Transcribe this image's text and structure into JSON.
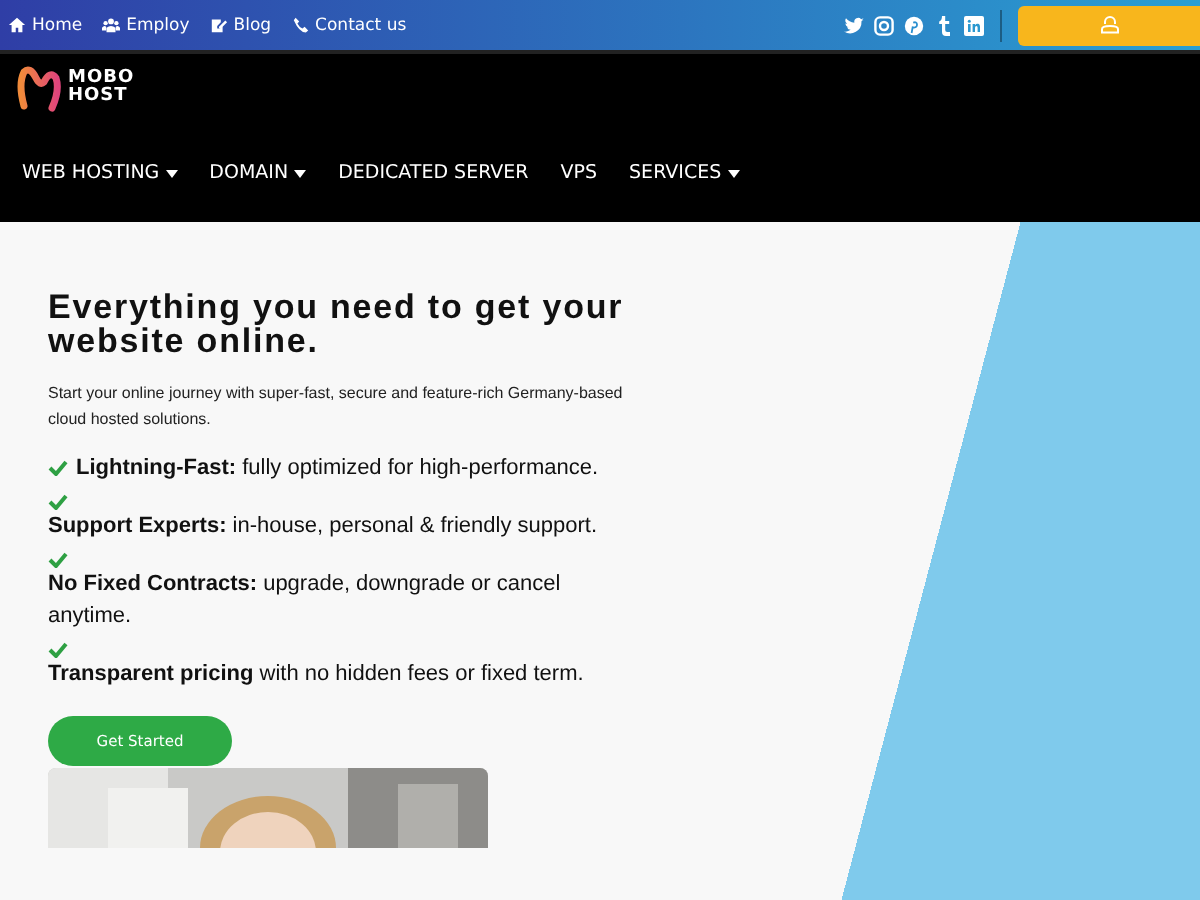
{
  "top_bar": {
    "links": [
      {
        "label": "Home"
      },
      {
        "label": "Employ"
      },
      {
        "label": "Blog"
      },
      {
        "label": "Contact us"
      }
    ]
  },
  "logo": {
    "line_1": "MOBO",
    "line_2": "HOST"
  },
  "nav": [
    {
      "label": "WEB HOSTING",
      "dropdown": true
    },
    {
      "label": "DOMAIN",
      "dropdown": true
    },
    {
      "label": "DEDICATED SERVER",
      "dropdown": false
    },
    {
      "label": "VPS",
      "dropdown": false
    },
    {
      "label": "SERVICES",
      "dropdown": true
    }
  ],
  "hero": {
    "title": "Everything you need to get your website online.",
    "subtitle": "Start your online journey with super-fast, secure and feature-rich Germany-based cloud hosted solutions.",
    "features": [
      {
        "kind": "inline",
        "text": "**Lightning-Fast:** fully optimized for high-performance."
      },
      {
        "kind": "stacked",
        "text": "**Support Experts:** in-house, personal & friendly support."
      },
      {
        "kind": "stacked",
        "text": "**No Fixed Contracts:** upgrade, downgrade or cancel anytime."
      },
      {
        "kind": "stacked",
        "text": "**Transparent pricing** with no hidden fees or fixed term."
      }
    ],
    "button": "Get Started"
  }
}
